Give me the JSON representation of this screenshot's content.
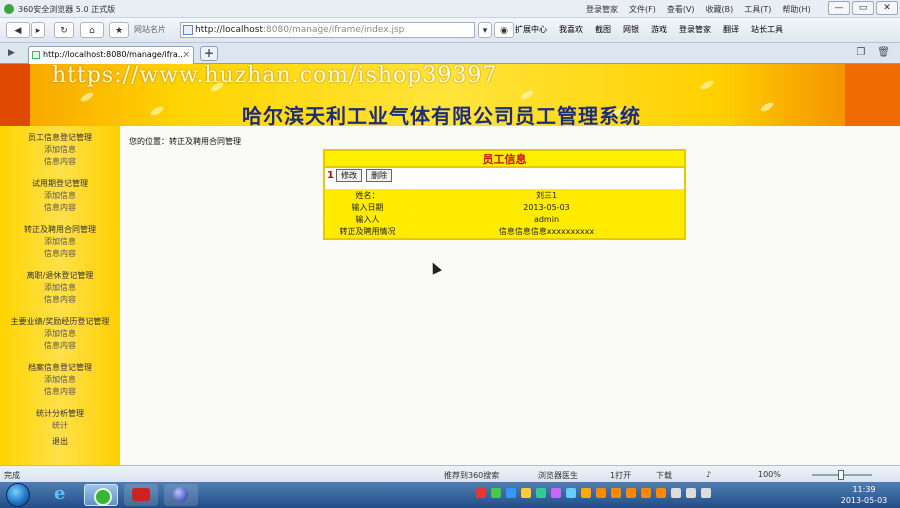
{
  "browser": {
    "title": "360安全浏览器 5.0 正式版",
    "menu": [
      "登录管家",
      "文件(F)",
      "查看(V)",
      "收藏(B)",
      "工具(T)",
      "帮助(H)"
    ],
    "window_controls": [
      "—",
      "▭",
      "✕"
    ],
    "toolbar": {
      "back_icon": "back-arrow-icon",
      "forward_icon": "forward-arrow-icon",
      "refresh_icon": "refresh-icon",
      "home_icon": "home-icon",
      "favorite_icon": "star-icon",
      "favorites_label": "网站名片",
      "address_host": "http://localhost",
      "address_rest": ":8080/manage/iframe/index.jsp",
      "links": [
        "扩展中心",
        "我喜欢",
        "截图",
        "网银",
        "游戏",
        "登录管家",
        "翻译",
        "站长工具"
      ]
    },
    "tab": {
      "label": "http://localhost:8080/manage/ifra...",
      "close": "×",
      "new_tab": "+"
    }
  },
  "banner": {
    "watermark": "https://www.huzhan.com/ishop39397",
    "title": "哈尔滨天利工业气体有限公司员工管理系统"
  },
  "sidebar": {
    "groups": [
      {
        "title": "员工信息登记管理",
        "items": [
          "添加信息",
          "信息内容"
        ]
      },
      {
        "title": "试用期登记管理",
        "items": [
          "添加信息",
          "信息内容"
        ]
      },
      {
        "title": "转正及聘用合同管理",
        "items": [
          "添加信息",
          "信息内容"
        ]
      },
      {
        "title": "离职/退休登记管理",
        "items": [
          "添加信息",
          "信息内容"
        ]
      },
      {
        "title": "主要业绩/奖励经历登记管理",
        "items": [
          "添加信息",
          "信息内容"
        ]
      },
      {
        "title": "档案信息登记管理",
        "items": [
          "添加信息",
          "信息内容"
        ]
      },
      {
        "title": "统计分析管理",
        "items": [
          "统计"
        ]
      },
      {
        "title": "退出",
        "items": []
      }
    ]
  },
  "content": {
    "breadcrumb": "您的位置：转正及聘用合同管理",
    "panel_title": "员工信息",
    "row_number": "1",
    "edit_button": "修改",
    "delete_button": "删除",
    "fields": [
      {
        "label": "姓名：",
        "value": "刘三1"
      },
      {
        "label": "输入日期",
        "value": "2013-05-03"
      },
      {
        "label": "输入人",
        "value": "admin"
      },
      {
        "label": "转正及聘用情况",
        "value": "信息信息信息xxxxxxxxxx"
      }
    ]
  },
  "statusbar": {
    "left": "完成",
    "recommend": "推荐到360搜索",
    "doctor": "浏览器医生",
    "open_label": "1打开",
    "download": "下载",
    "zoom": "100%"
  },
  "taskbar": {
    "time": "11:39",
    "date": "2013-05-03"
  }
}
